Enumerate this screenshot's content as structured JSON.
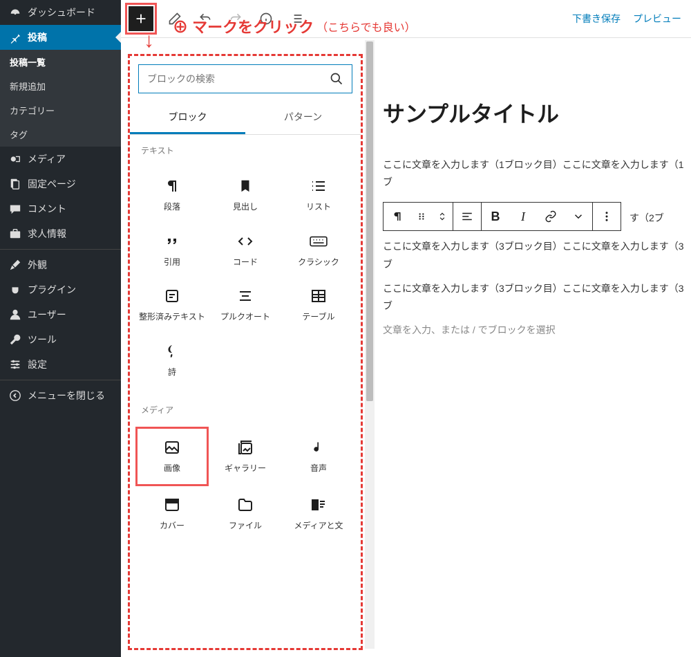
{
  "sidebar": {
    "dashboard": "ダッシュボード",
    "posts": "投稿",
    "posts_sub": [
      "投稿一覧",
      "新規追加",
      "カテゴリー",
      "タグ"
    ],
    "media": "メディア",
    "pages": "固定ページ",
    "comments": "コメント",
    "jobs": "求人情報",
    "appearance": "外観",
    "plugins": "プラグイン",
    "users": "ユーザー",
    "tools": "ツール",
    "settings": "設定",
    "collapse": "メニューを閉じる"
  },
  "topbar": {
    "save_draft": "下書き保存",
    "preview": "プレビュー"
  },
  "annotation": {
    "main": "⊕ マークをクリック",
    "sub": "（こちらでも良い）"
  },
  "inserter": {
    "search_placeholder": "ブロックの検索",
    "tabs": {
      "blocks": "ブロック",
      "patterns": "パターン"
    },
    "section_text": "テキスト",
    "section_media": "メディア",
    "blocks_text": [
      {
        "label": "段落",
        "icon": "paragraph"
      },
      {
        "label": "見出し",
        "icon": "bookmark"
      },
      {
        "label": "リスト",
        "icon": "list"
      },
      {
        "label": "引用",
        "icon": "quote"
      },
      {
        "label": "コード",
        "icon": "code"
      },
      {
        "label": "クラシック",
        "icon": "keyboard"
      },
      {
        "label": "整形済みテキスト",
        "icon": "preformatted"
      },
      {
        "label": "プルクオート",
        "icon": "pullquote"
      },
      {
        "label": "テーブル",
        "icon": "table"
      },
      {
        "label": "詩",
        "icon": "verse"
      }
    ],
    "blocks_media": [
      {
        "label": "画像",
        "icon": "image",
        "highlight": true
      },
      {
        "label": "ギャラリー",
        "icon": "gallery"
      },
      {
        "label": "音声",
        "icon": "audio"
      },
      {
        "label": "カバー",
        "icon": "cover"
      },
      {
        "label": "ファイル",
        "icon": "file"
      },
      {
        "label": "メディアと文",
        "icon": "media-text"
      }
    ]
  },
  "editor": {
    "title": "サンプルタイトル",
    "p1": "ここに文章を入力します（1ブロック目）ここに文章を入力します（1ブ",
    "tb_tail": "す（2ブ",
    "p3a": "ここに文章を入力します（3ブロック目）ここに文章を入力します（3ブ",
    "p3b": "ここに文章を入力します（3ブロック目）ここに文章を入力します（3ブ",
    "placeholder": "文章を入力、または / でブロックを選択"
  }
}
